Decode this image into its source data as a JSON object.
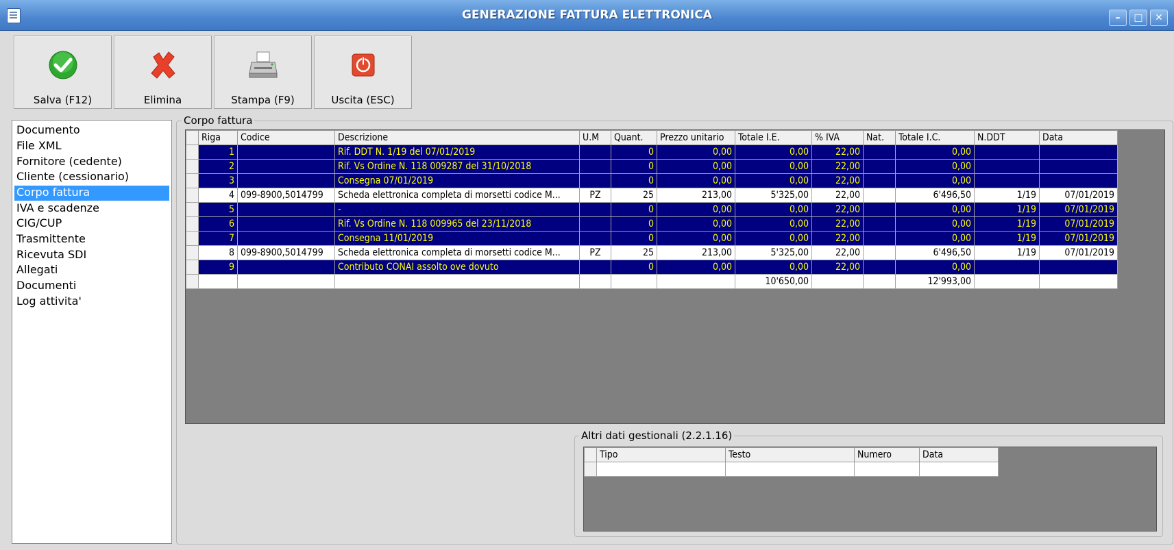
{
  "window": {
    "title": "GENERAZIONE FATTURA ELETTRONICA",
    "controls": {
      "minimize": "–",
      "maximize": "□",
      "close": "✕"
    }
  },
  "toolbar": [
    {
      "label": "Salva (F12)",
      "icon": "check-icon"
    },
    {
      "label": "Elimina",
      "icon": "delete-x-icon"
    },
    {
      "label": "Stampa (F9)",
      "icon": "printer-icon"
    },
    {
      "label": "Uscita (ESC)",
      "icon": "power-icon"
    }
  ],
  "sidebar": {
    "items": [
      "Documento",
      "File XML",
      "Fornitore (cedente)",
      "Cliente (cessionario)",
      "Corpo fattura",
      "IVA e scadenze",
      "CIG/CUP",
      "Trasmittente",
      "Ricevuta SDI",
      "Allegati",
      "Documenti",
      "Log attivita'"
    ],
    "selected_index": 4
  },
  "corpo_fattura": {
    "group_label": "Corpo fattura",
    "columns": [
      "Riga",
      "Codice",
      "Descrizione",
      "U.M",
      "Quant.",
      "Prezzo unitario",
      "Totale I.E.",
      "% IVA",
      "Nat.",
      "Totale I.C.",
      "N.DDT",
      "Data"
    ],
    "rows": [
      {
        "type": "comment",
        "cells": [
          "1",
          "",
          "Rif. DDT N. 1/19 del 07/01/2019",
          "",
          "0",
          "0,00",
          "0,00",
          "22,00",
          "",
          "0,00",
          "",
          ""
        ]
      },
      {
        "type": "comment",
        "cells": [
          "2",
          "",
          "Rif. Vs Ordine N. 118 009287 del 31/10/2018",
          "",
          "0",
          "0,00",
          "0,00",
          "22,00",
          "",
          "0,00",
          "",
          ""
        ]
      },
      {
        "type": "comment",
        "cells": [
          "3",
          "",
          "Consegna 07/01/2019",
          "",
          "0",
          "0,00",
          "0,00",
          "22,00",
          "",
          "0,00",
          "",
          ""
        ]
      },
      {
        "type": "item",
        "cells": [
          "4",
          "099-8900,5014799",
          "Scheda elettronica completa di morsetti codice M...",
          "PZ",
          "25",
          "213,00",
          "5'325,00",
          "22,00",
          "",
          "6'496,50",
          "1/19",
          "07/01/2019"
        ]
      },
      {
        "type": "comment",
        "cells": [
          "5",
          "",
          "-",
          "",
          "0",
          "0,00",
          "0,00",
          "22,00",
          "",
          "0,00",
          "1/19",
          "07/01/2019"
        ]
      },
      {
        "type": "comment",
        "cells": [
          "6",
          "",
          "Rif. Vs Ordine N. 118 009965 del 23/11/2018",
          "",
          "0",
          "0,00",
          "0,00",
          "22,00",
          "",
          "0,00",
          "1/19",
          "07/01/2019"
        ]
      },
      {
        "type": "comment",
        "cells": [
          "7",
          "",
          "Consegna 11/01/2019",
          "",
          "0",
          "0,00",
          "0,00",
          "22,00",
          "",
          "0,00",
          "1/19",
          "07/01/2019"
        ]
      },
      {
        "type": "item",
        "cells": [
          "8",
          "099-8900,5014799",
          "Scheda elettronica completa di morsetti codice M...",
          "PZ",
          "25",
          "213,00",
          "5'325,00",
          "22,00",
          "",
          "6'496,50",
          "1/19",
          "07/01/2019"
        ]
      },
      {
        "type": "comment",
        "cells": [
          "9",
          "",
          "Contributo CONAI assolto ove dovuto",
          "",
          "0",
          "0,00",
          "0,00",
          "22,00",
          "",
          "0,00",
          "",
          ""
        ]
      }
    ],
    "totals": {
      "totale_ie": "10'650,00",
      "totale_ic": "12'993,00"
    }
  },
  "altri_dati": {
    "group_label": "Altri dati gestionali (2.2.1.16)",
    "columns": [
      "Tipo",
      "Testo",
      "Numero",
      "Data"
    ]
  },
  "colors": {
    "comment_row_bg": "#000080",
    "comment_row_text": "#ffff00",
    "selection": "#3399ff",
    "grid_background": "#808080"
  }
}
